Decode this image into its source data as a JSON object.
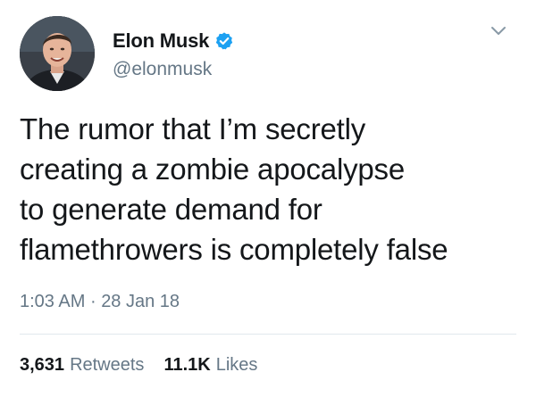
{
  "user": {
    "display_name": "Elon Musk",
    "handle": "@elonmusk",
    "verified": true,
    "verified_color": "#1da1f2"
  },
  "tweet": {
    "text_lines": [
      "The rumor that I’m secretly",
      "creating a zombie apocalypse",
      "to generate demand for",
      "flamethrowers is completely false"
    ],
    "time": "1:03 AM",
    "separator": "·",
    "date": "28 Jan 18"
  },
  "stats": {
    "retweets_count": "3,631",
    "retweets_label": "Retweets",
    "likes_count": "11.1K",
    "likes_label": "Likes"
  },
  "icons": {
    "verified": "verified-badge-icon",
    "menu": "chevron-down-icon"
  },
  "colors": {
    "text_primary": "#14171a",
    "text_secondary": "#657786",
    "divider": "#e1e8ed"
  }
}
